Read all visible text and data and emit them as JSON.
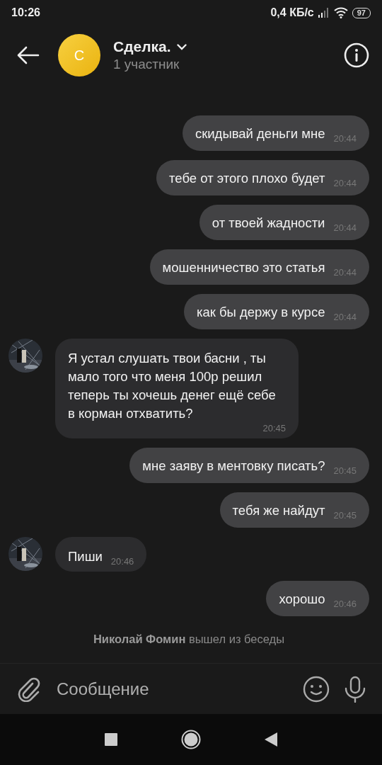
{
  "status_bar": {
    "time": "10:26",
    "network_speed": "0,4 КБ/с",
    "battery": "97"
  },
  "header": {
    "avatar_letter": "С",
    "title": "Сделка.",
    "subtitle": "1 участник"
  },
  "messages": [
    {
      "kind": "outgoing",
      "text": "скидывай деньги мне",
      "time": "20:44"
    },
    {
      "kind": "outgoing",
      "text": "тебе от этого плохо будет",
      "time": "20:44"
    },
    {
      "kind": "outgoing",
      "text": "от твоей жадности",
      "time": "20:44"
    },
    {
      "kind": "outgoing",
      "text": "мошенничество это статья",
      "time": "20:44"
    },
    {
      "kind": "outgoing",
      "text": "как бы держу в курсе",
      "time": "20:44"
    },
    {
      "kind": "incoming",
      "text": "Я устал слушать твои басни , ты мало того что меня 100р решил теперь ты хочешь денег ещё себе в корман отхватить?",
      "time": "20:45"
    },
    {
      "kind": "outgoing",
      "text": "мне заяву в ментовку писать?",
      "time": "20:45"
    },
    {
      "kind": "outgoing",
      "text": "тебя же найдут",
      "time": "20:45"
    },
    {
      "kind": "incoming",
      "text": "Пиши",
      "time": "20:46"
    },
    {
      "kind": "outgoing",
      "text": "хорошо",
      "time": "20:46"
    },
    {
      "kind": "system",
      "text": "**Николай Фомин** вышел из беседы"
    }
  ],
  "composer": {
    "placeholder": "Сообщение"
  }
}
